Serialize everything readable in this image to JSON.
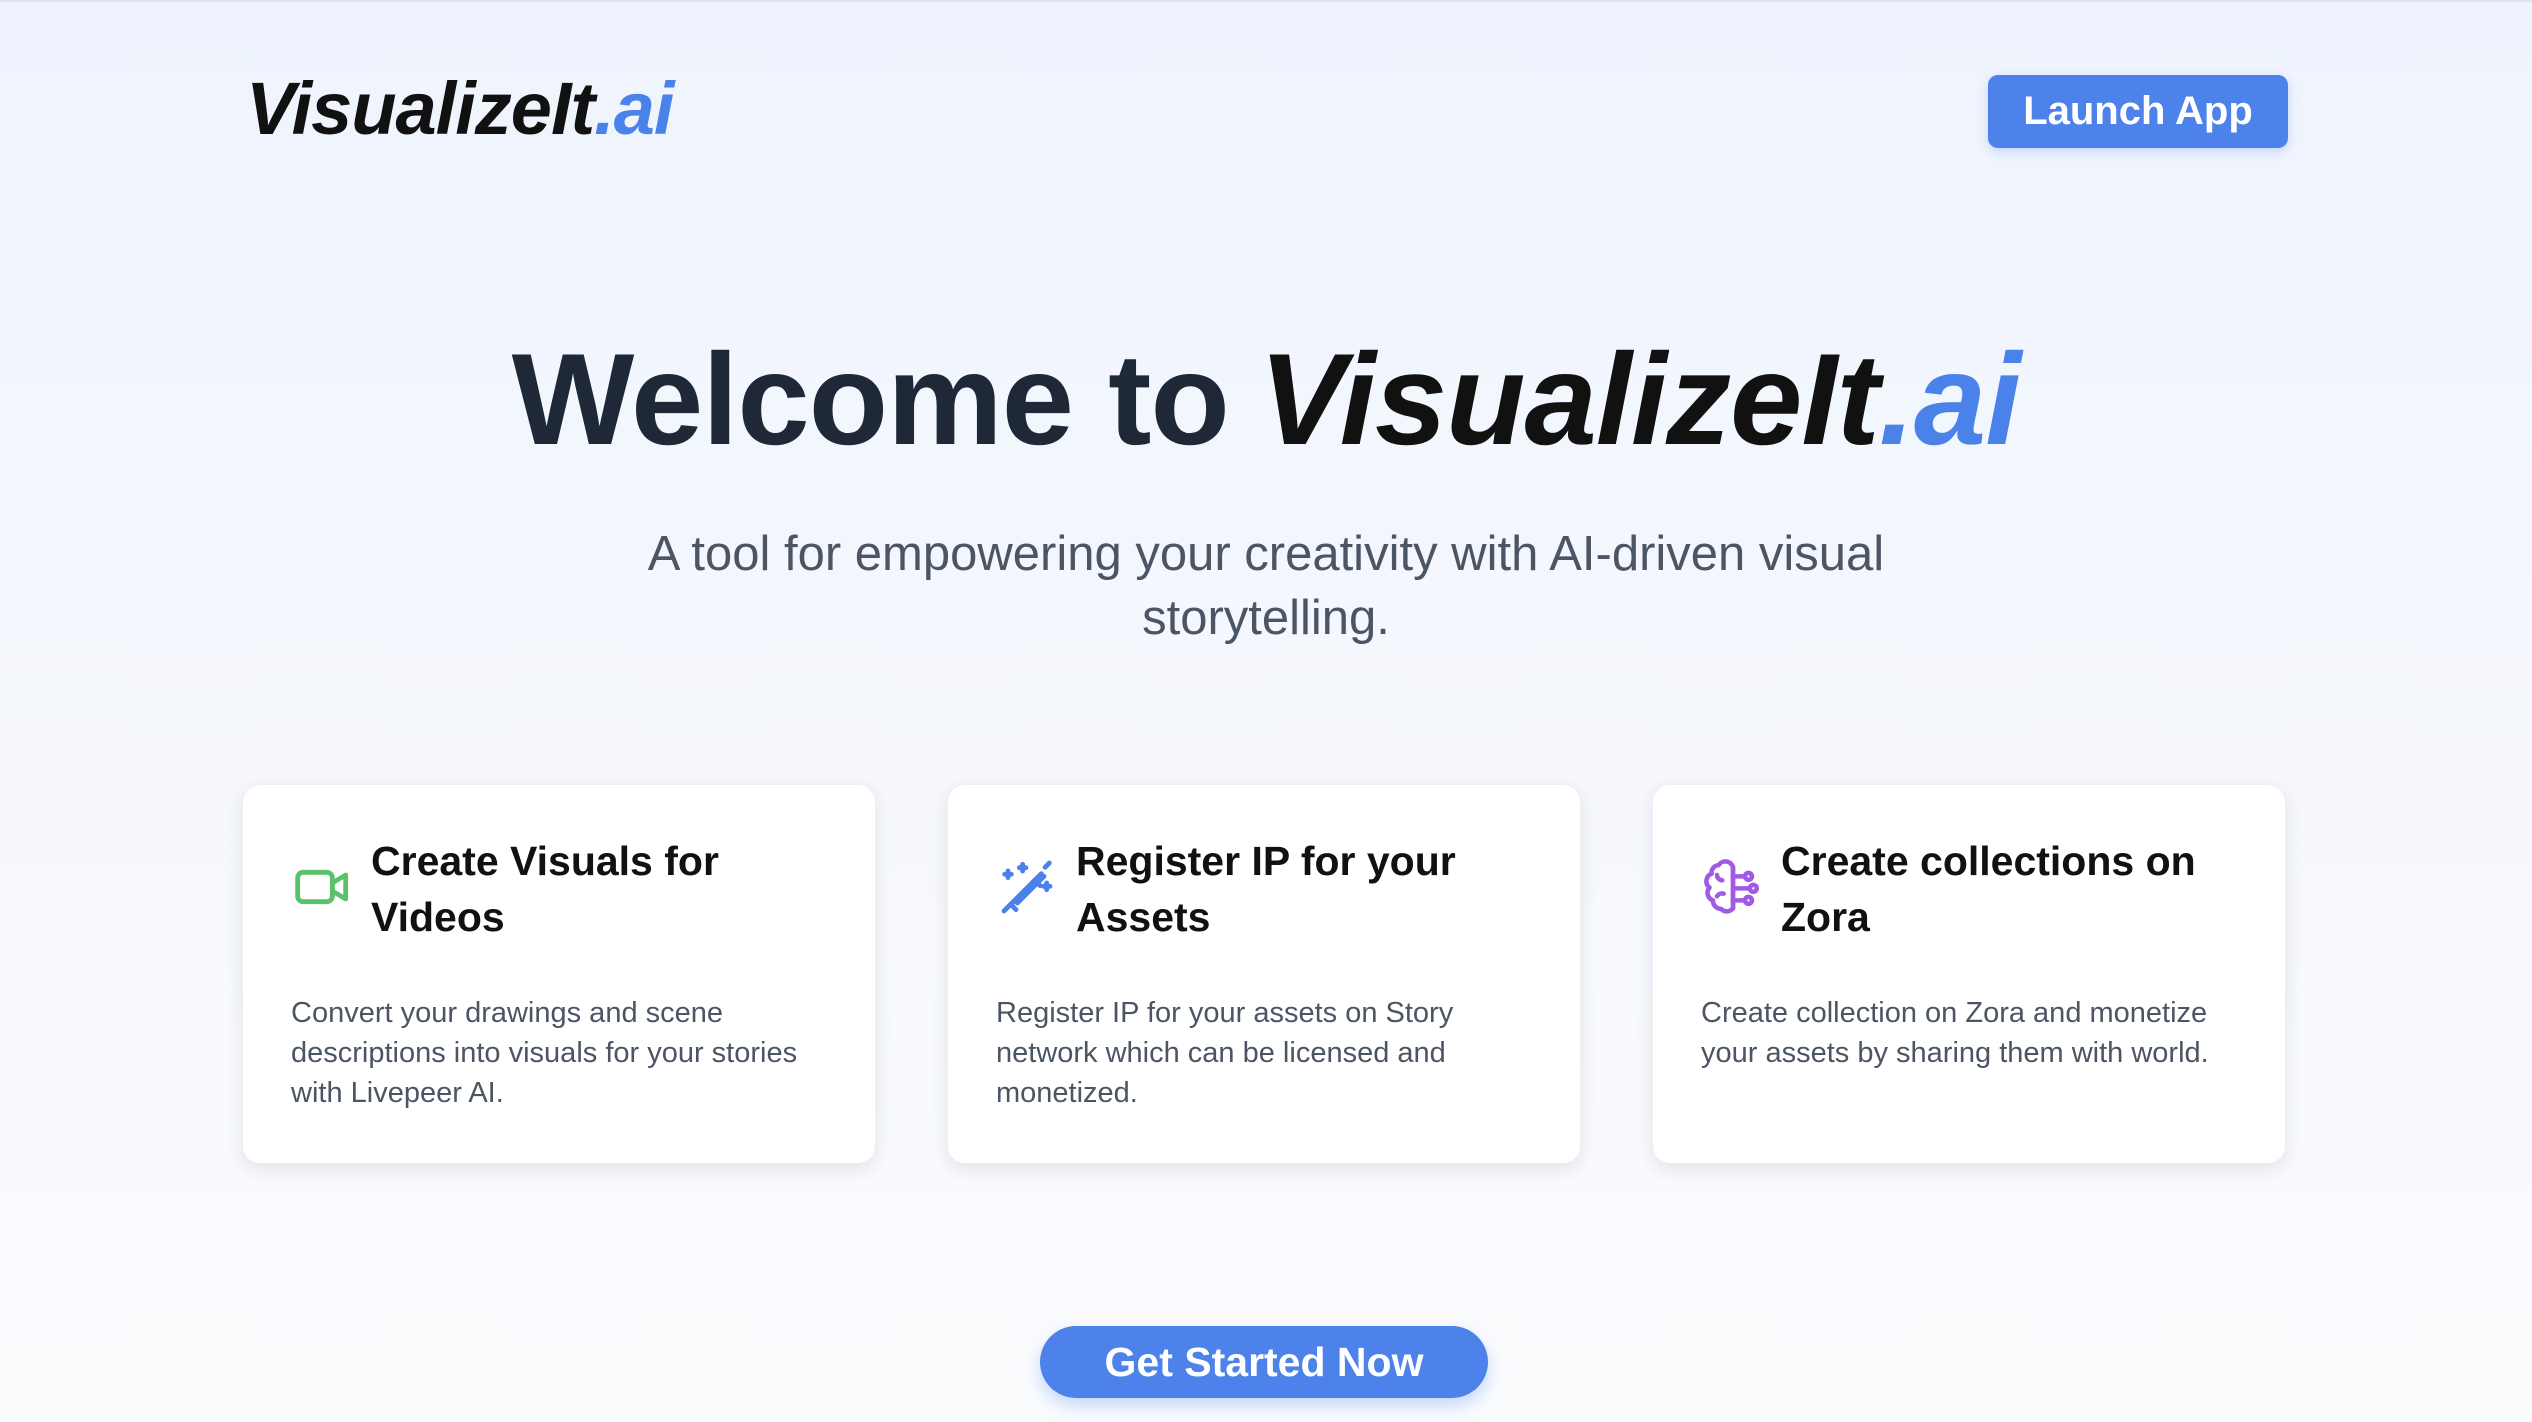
{
  "header": {
    "logo_main": "VisualizeIt",
    "logo_accent": ".ai",
    "launch_label": "Launch App"
  },
  "hero": {
    "welcome": "Welcome to",
    "brand_main": "VisualizeIt",
    "brand_accent": ".ai",
    "subtitle": "A tool for empowering your creativity with AI-driven visual storytelling."
  },
  "features": [
    {
      "icon": "video-camera-icon",
      "title": "Create Visuals for Videos",
      "description": "Convert your drawings and scene descriptions into visuals for your stories with Livepeer AI."
    },
    {
      "icon": "magic-wand-icon",
      "title": "Register IP for your Assets",
      "description": "Register IP for your assets on Story network which can be licensed and monetized."
    },
    {
      "icon": "brain-circuit-icon",
      "title": "Create collections on Zora",
      "description": "Create collection on Zora and monetize your assets by sharing them with world."
    }
  ],
  "cta": {
    "label": "Get Started Now"
  },
  "colors": {
    "accent": "#4c82ea",
    "video_icon": "#5cc26a",
    "wand_icon": "#4a82ea",
    "brain_icon": "#a05ae6"
  }
}
